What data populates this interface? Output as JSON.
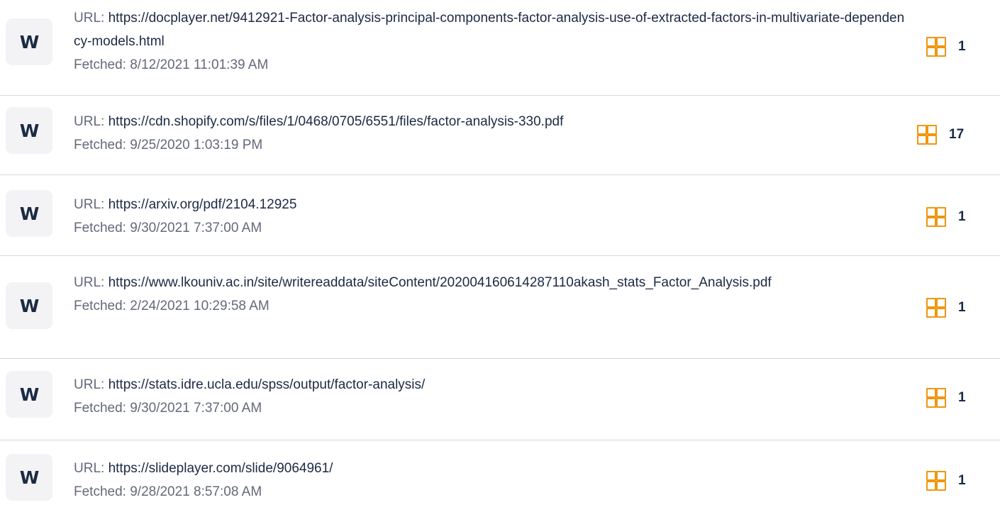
{
  "url_prefix": "URL:",
  "fetched_prefix": "Fetched:",
  "badge_letter": "W",
  "icon": "grid-icon",
  "colors": {
    "accent": "#f0960f",
    "text": "#1b2a44",
    "muted": "#63697a",
    "badge_bg": "#f3f3f5",
    "divider": "#d8d8dc"
  },
  "sources": [
    {
      "url": "https://docplayer.net/9412921-Factor-analysis-principal-components-factor-analysis-use-of-extracted-factors-in-multivariate-dependency-models.html",
      "fetched": "8/12/2021 11:01:39 AM",
      "count": "1"
    },
    {
      "url": "https://cdn.shopify.com/s/files/1/0468/0705/6551/files/factor-analysis-330.pdf",
      "fetched": "9/25/2020 1:03:19 PM",
      "count": "17"
    },
    {
      "url": "https://arxiv.org/pdf/2104.12925",
      "fetched": "9/30/2021 7:37:00 AM",
      "count": "1"
    },
    {
      "url": "https://www.lkouniv.ac.in/site/writereaddata/siteContent/202004160614287110akash_stats_Factor_Analysis.pdf",
      "fetched": "2/24/2021 10:29:58 AM",
      "count": "1"
    },
    {
      "url": "https://stats.idre.ucla.edu/spss/output/factor-analysis/",
      "fetched": "9/30/2021 7:37:00 AM",
      "count": "1"
    },
    {
      "url": "https://slideplayer.com/slide/9064961/",
      "fetched": "9/28/2021 8:57:08 AM",
      "count": "1"
    }
  ]
}
